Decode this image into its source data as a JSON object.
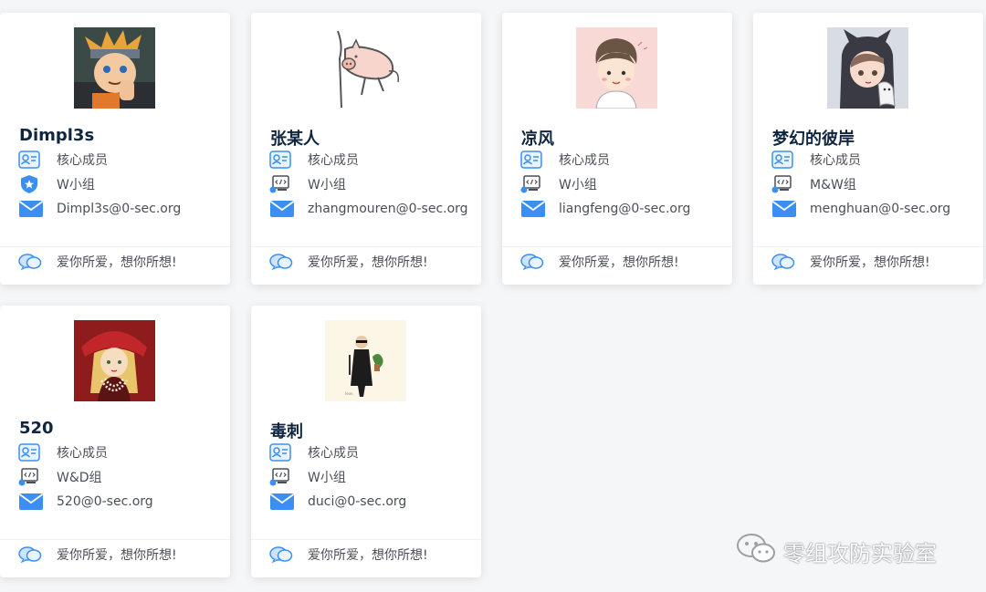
{
  "members": [
    {
      "name": "Dimpl3s",
      "role": "核心成员",
      "group": "W小组",
      "group_icon": "shield-star-icon",
      "email": "Dimpl3s@0-sec.org",
      "motto": "爱你所爱，想你所想!",
      "avatar": "naruto-avatar"
    },
    {
      "name": "张某人",
      "role": "核心成员",
      "group": "W小组",
      "group_icon": "code-monitor-icon",
      "email": "zhangmouren@0-sec.org",
      "motto": "爱你所爱，想你所想!",
      "avatar": "pig-sketch-avatar"
    },
    {
      "name": "凉风",
      "role": "核心成员",
      "group": "W小组",
      "group_icon": "code-monitor-icon",
      "email": "liangfeng@0-sec.org",
      "motto": "爱你所爱，想你所想!",
      "avatar": "cartoon-boy-avatar"
    },
    {
      "name": "梦幻的彼岸",
      "role": "核心成员",
      "group": "M&W组",
      "group_icon": "code-monitor-icon",
      "email": "menghuan@0-sec.org",
      "motto": "爱你所爱，想你所想!",
      "avatar": "anime-girl-avatar"
    },
    {
      "name": "520",
      "role": "核心成员",
      "group": "W&D组",
      "group_icon": "code-monitor-icon",
      "email": "520@0-sec.org",
      "motto": "爱你所爱，想你所想!",
      "avatar": "blonde-girl-avatar"
    },
    {
      "name": "毒刺",
      "role": "核心成员",
      "group": "W小组",
      "group_icon": "code-monitor-icon",
      "email": "duci@0-sec.org",
      "motto": "爱你所爱，想你所想!",
      "avatar": "man-in-black-avatar"
    }
  ],
  "watermark": {
    "text": "零组攻防实验室",
    "icon": "wechat-icon"
  },
  "colors": {
    "accent_blue": "#3c8ff2",
    "name_text": "#10263f",
    "body_text": "#4a4f57"
  }
}
